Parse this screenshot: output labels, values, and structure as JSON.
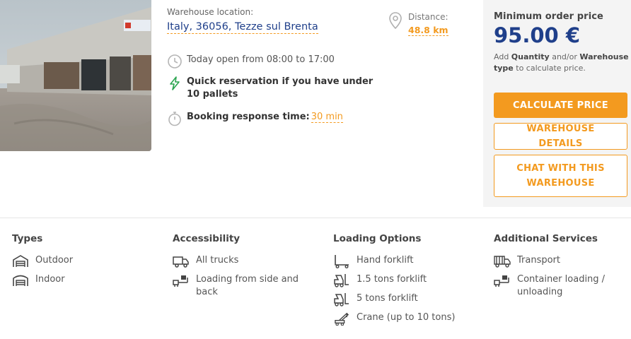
{
  "location": {
    "label": "Warehouse location:",
    "value": "Italy, 36056, Tezze sul Brenta"
  },
  "distance": {
    "label": "Distance:",
    "value": "48.8 km"
  },
  "features": {
    "hours": "Today open from 08:00 to 17:00",
    "quick": "Quick reservation if you have under 10 pallets",
    "booking_label": "Booking response time:",
    "booking_value": "30 min"
  },
  "pricebox": {
    "title": "Minimum order price",
    "price": "95.00 €",
    "note_pre": "Add",
    "note_q": "Quantity",
    "note_mid": "and/or",
    "note_w": "Warehouse type",
    "note_post": "to calculate price.",
    "calc": "CALCULATE PRICE",
    "details": "WAREHOUSE DETAILS",
    "chat": "CHAT WITH THIS WAREHOUSE"
  },
  "types": {
    "title": "Types",
    "items": [
      "Outdoor",
      "Indoor"
    ]
  },
  "accessibility": {
    "title": "Accessibility",
    "items": [
      "All trucks",
      "Loading from side and back"
    ]
  },
  "loading": {
    "title": "Loading Options",
    "items": [
      "Hand forklift",
      "1.5 tons forklift",
      "5 tons forklift",
      "Crane (up to 10 tons)"
    ]
  },
  "services": {
    "title": "Additional Services",
    "items": [
      "Transport",
      "Container loading / unloading"
    ]
  },
  "colors": {
    "accent": "#f39a1f",
    "brand": "#1f3f8a",
    "panel": "#f4f4f4",
    "quick_icon": "#2aa44f"
  },
  "icons": [
    "location-pin-icon",
    "clock-icon",
    "lightning-icon",
    "stopwatch-icon",
    "outdoor-icon",
    "indoor-icon",
    "truck-icon",
    "loading-icon",
    "hand-forklift-icon",
    "forklift-icon",
    "crane-icon",
    "transport-icon",
    "container-icon"
  ]
}
